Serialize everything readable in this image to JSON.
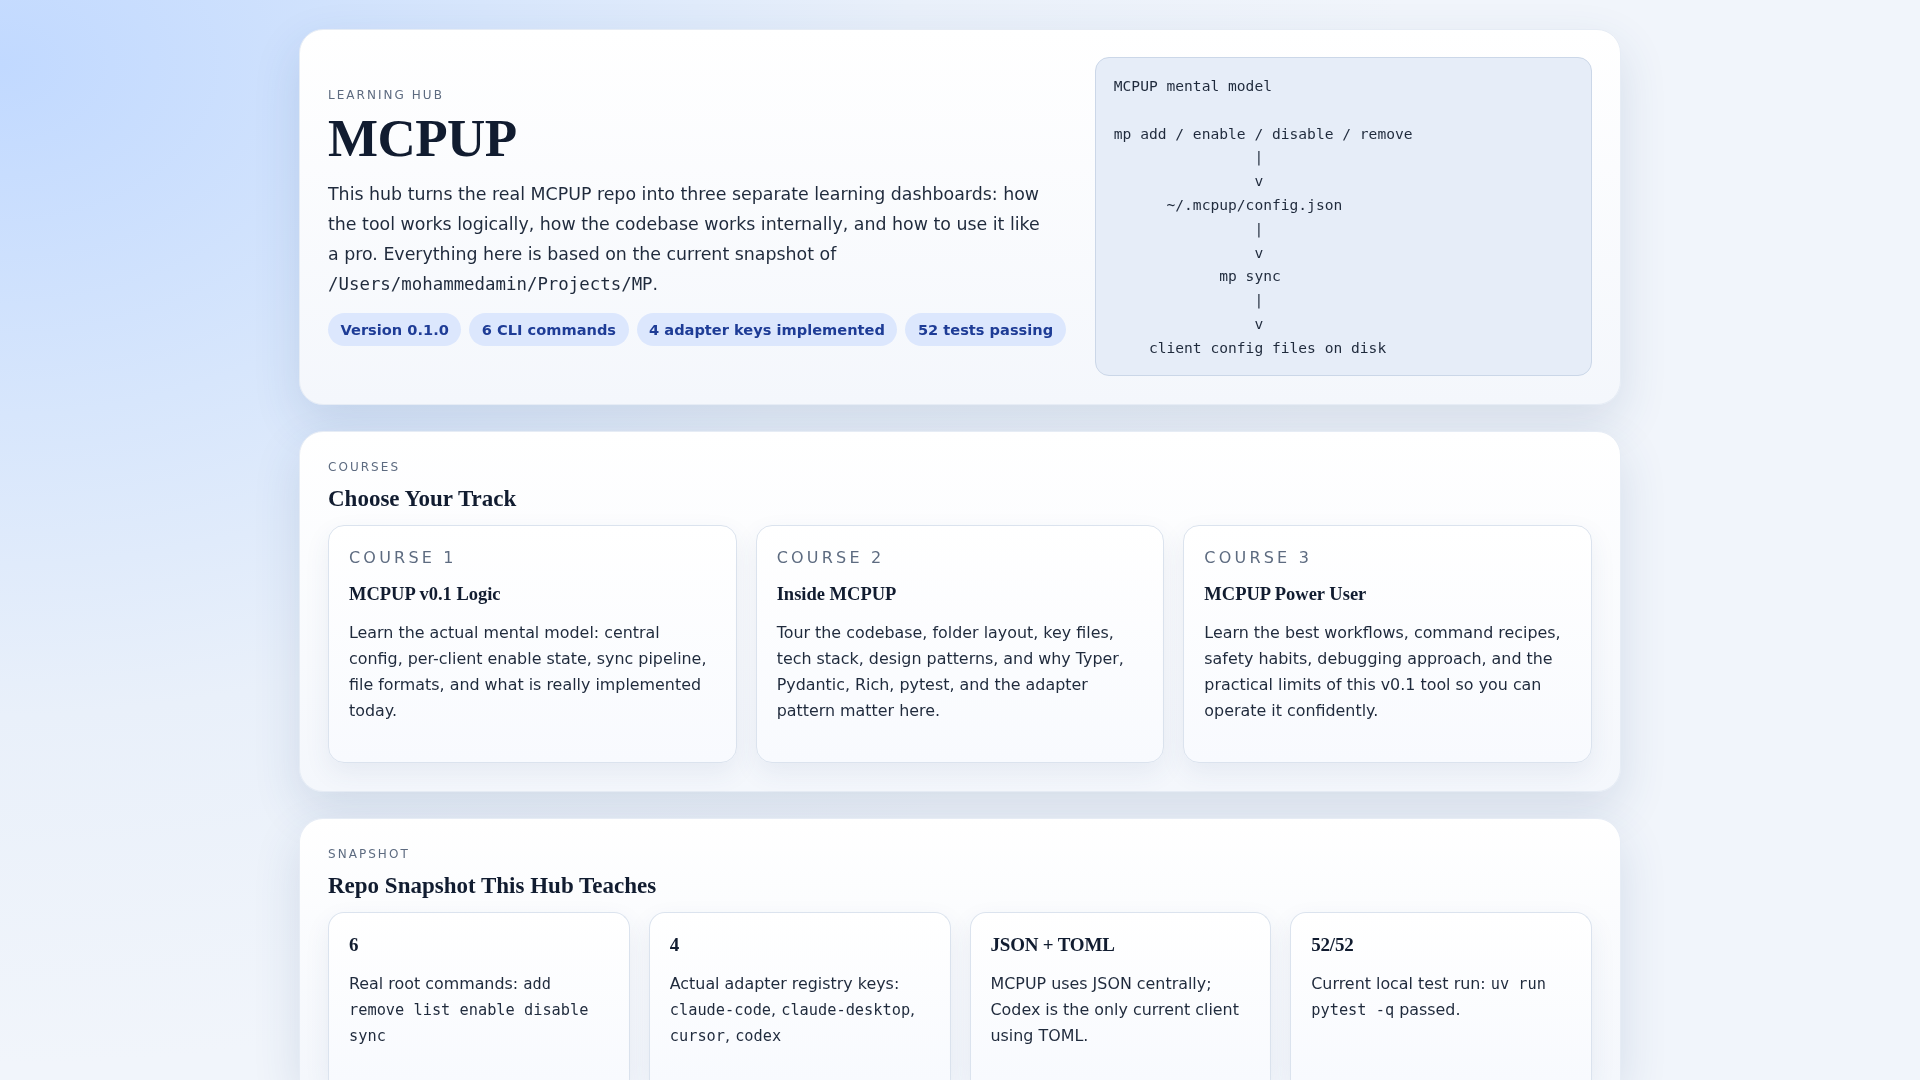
{
  "hero": {
    "eyebrow": "LEARNING HUB",
    "title": "MCPUP",
    "description": [
      {
        "kind": "text",
        "text": "This hub turns the real MCPUP repo into three separate learning dashboards: how the tool works logically, how the codebase works internally, and how to use it like a pro. Everything here is based on the current snapshot of "
      },
      {
        "kind": "code",
        "text": "/Users/mohammedamin/Projects/MP"
      },
      {
        "kind": "text",
        "text": "."
      }
    ],
    "badges": [
      "Version 0.1.0",
      "6 CLI commands",
      "4 adapter keys implemented",
      "52 tests passing"
    ],
    "code_block": {
      "title": "MCPUP mental model",
      "lines": [
        "mp add / enable / disable / remove",
        "                |",
        "                v",
        "      ~/.mcpup/config.json",
        "                |",
        "                v",
        "            mp sync",
        "                |",
        "                v",
        "    client config files on disk"
      ]
    }
  },
  "courses": {
    "eyebrow": "COURSES",
    "heading": "Choose Your Track",
    "cards": [
      {
        "label": "COURSE 1",
        "title": "MCPUP v0.1 Logic",
        "description": "Learn the actual mental model: central config, per-client enable state, sync pipeline, file formats, and what is really implemented today."
      },
      {
        "label": "COURSE 2",
        "title": "Inside MCPUP",
        "description": "Tour the codebase, folder layout, key files, tech stack, design patterns, and why Typer, Pydantic, Rich, pytest, and the adapter pattern matter here."
      },
      {
        "label": "COURSE 3",
        "title": "MCPUP Power User",
        "description": "Learn the best workflows, command recipes, safety habits, debugging approach, and the practical limits of this v0.1 tool so you can operate it confidently."
      }
    ]
  },
  "snapshot": {
    "eyebrow": "SNAPSHOT",
    "heading": "Repo Snapshot This Hub Teaches",
    "cards": [
      {
        "value": "6",
        "description": [
          {
            "kind": "text",
            "text": "Real root commands: "
          },
          {
            "kind": "code",
            "text": "add remove list enable disable sync"
          }
        ]
      },
      {
        "value": "4",
        "description": [
          {
            "kind": "text",
            "text": "Actual adapter registry keys: "
          },
          {
            "kind": "code",
            "text": "claude-code"
          },
          {
            "kind": "text",
            "text": ", "
          },
          {
            "kind": "code",
            "text": "claude-desktop"
          },
          {
            "kind": "text",
            "text": ", "
          },
          {
            "kind": "code",
            "text": "cursor"
          },
          {
            "kind": "text",
            "text": ", "
          },
          {
            "kind": "code",
            "text": "codex"
          }
        ]
      },
      {
        "value": "JSON + TOML",
        "description": [
          {
            "kind": "text",
            "text": "MCPUP uses JSON centrally; Codex is the only current client using TOML."
          }
        ]
      },
      {
        "value": "52/52",
        "description": [
          {
            "kind": "text",
            "text": "Current local test run: "
          },
          {
            "kind": "code",
            "text": "uv run pytest -q"
          },
          {
            "kind": "text",
            "text": " passed."
          }
        ]
      }
    ]
  }
}
